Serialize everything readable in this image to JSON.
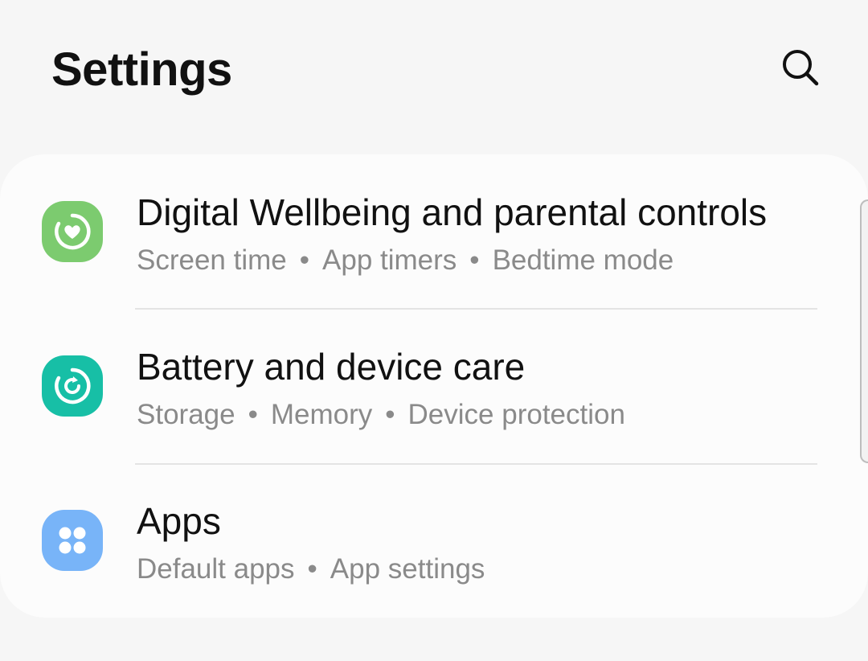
{
  "header": {
    "title": "Settings",
    "search_icon": "search-icon"
  },
  "settings_items": [
    {
      "title": "Digital Wellbeing and parental controls",
      "subtitle": [
        "Screen time",
        "App timers",
        "Bedtime mode"
      ],
      "icon": "digital-wellbeing-icon",
      "icon_color": "#7ccb6f"
    },
    {
      "title": "Battery and device care",
      "subtitle": [
        "Storage",
        "Memory",
        "Device protection"
      ],
      "icon": "device-care-icon",
      "icon_color": "#17bfa6"
    },
    {
      "title": "Apps",
      "subtitle": [
        "Default apps",
        "App settings"
      ],
      "icon": "apps-icon",
      "icon_color": "#78b4f8"
    }
  ],
  "separator": "•"
}
